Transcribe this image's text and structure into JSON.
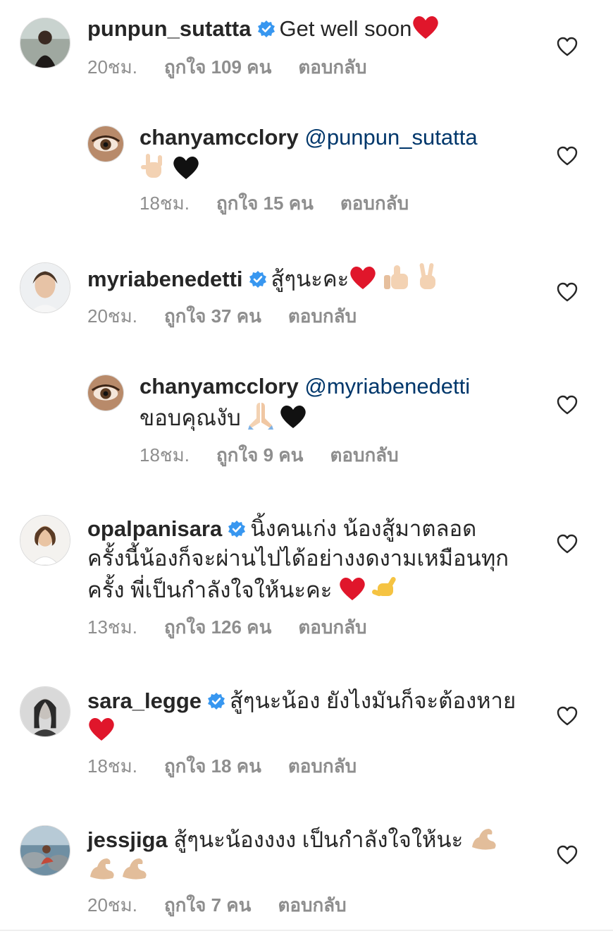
{
  "comments": [
    {
      "username": "punpun_sutatta",
      "verified": true,
      "mention": "",
      "text": "Get well soon",
      "time": "20ชม.",
      "likes": "ถูกใจ 109 คน",
      "reply": "ตอบกลับ"
    },
    {
      "username": "chanyamcclory",
      "verified": false,
      "mention": "@punpun_sutatta",
      "text": "",
      "time": "18ชม.",
      "likes": "ถูกใจ 15 คน",
      "reply": "ตอบกลับ"
    },
    {
      "username": "myriabenedetti",
      "verified": true,
      "mention": "",
      "text": "สู้ๆนะคะ",
      "time": "20ชม.",
      "likes": "ถูกใจ 37 คน",
      "reply": "ตอบกลับ"
    },
    {
      "username": "chanyamcclory",
      "verified": false,
      "mention": "@myriabenedetti",
      "text": "ขอบคุณงับ",
      "time": "18ชม.",
      "likes": "ถูกใจ 9 คน",
      "reply": "ตอบกลับ"
    },
    {
      "username": "opalpanisara",
      "verified": true,
      "mention": "",
      "text_line1": "นิ้งคนเก่ง น้องสู้มาตลอด",
      "text_line2": "ครั้งนี้น้องก็จะผ่านไปได้อย่างงดงามเหมือนทุก",
      "text_line3": "ครั้ง พี่เป็นกำลังใจให้นะคะ",
      "time": "13ชม.",
      "likes": "ถูกใจ 126 คน",
      "reply": "ตอบกลับ"
    },
    {
      "username": "sara_legge",
      "verified": true,
      "mention": "",
      "text": "สู้ๆนะน้อง ยังไงมันก็จะต้องหาย",
      "time": "18ชม.",
      "likes": "ถูกใจ 18 คน",
      "reply": "ตอบกลับ"
    },
    {
      "username": "jessjiga",
      "verified": false,
      "mention": "",
      "text": "สู้ๆนะน้องงงง เป็นกำลังใจให้นะ",
      "time": "20ชม.",
      "likes": "ถูกใจ 7 คน",
      "reply": "ตอบกลับ"
    }
  ],
  "icons": {
    "verified_badge": "verified-badge-icon",
    "like": "heart-outline-icon",
    "colors": {
      "verified": "#3897f0",
      "heart_emoji": "#e0162b",
      "black_heart": "#111111",
      "skin": "#f3d2b3",
      "meta_text": "#8e8e8e",
      "mention": "#00376b"
    }
  }
}
